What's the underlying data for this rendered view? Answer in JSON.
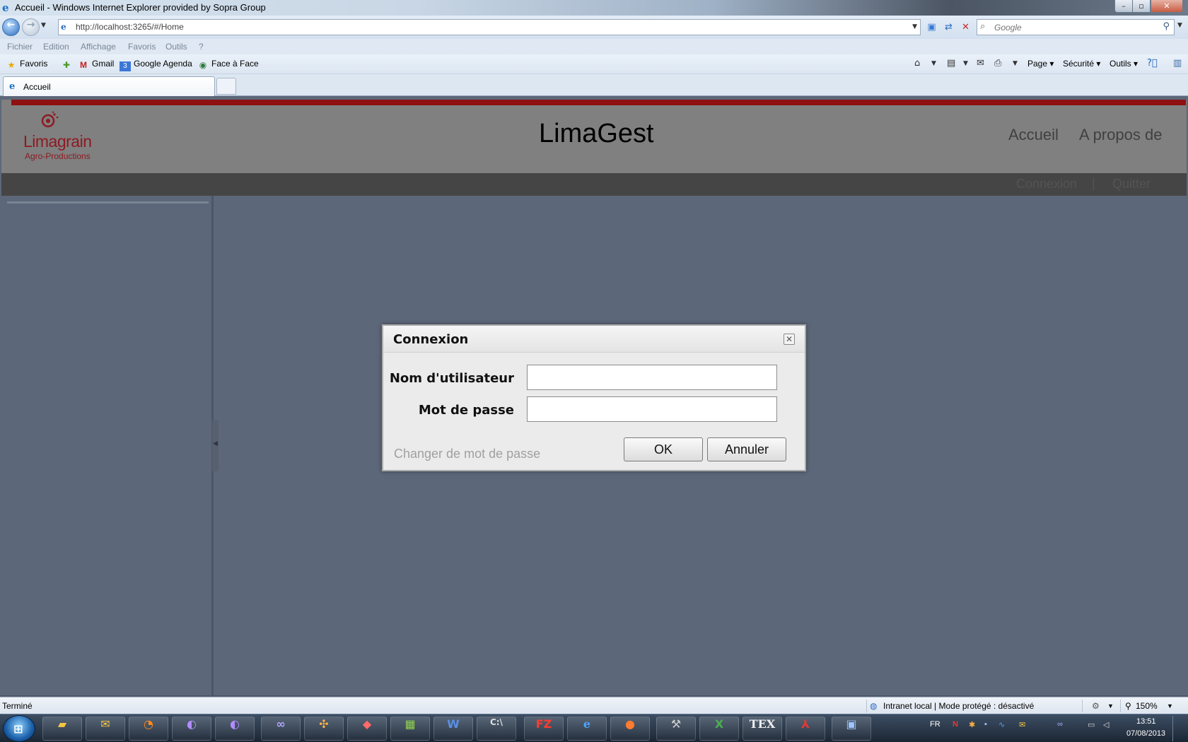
{
  "window": {
    "title": "Accueil - Windows Internet Explorer provided by Sopra Group",
    "minimize_glyph": "–",
    "maximize_glyph": "▫",
    "close_glyph": "✕"
  },
  "browser": {
    "url": "http://localhost:3265/#/Home",
    "search_placeholder": "Google",
    "menu": [
      "Fichier",
      "Edition",
      "Affichage",
      "Favoris",
      "Outils",
      "?"
    ],
    "favorites_label": "Favoris",
    "favorites": [
      "Gmail",
      "Google Agenda",
      "Face à Face"
    ],
    "commands": [
      "Page",
      "Sécurité",
      "Outils"
    ],
    "tab_label": "Accueil"
  },
  "app": {
    "logo_brand": "Limagrain",
    "logo_sub": "Agro-Productions",
    "title": "LimaGest",
    "nav": [
      "Accueil",
      "A propos de"
    ],
    "subnav": [
      "Connexion",
      "|",
      "Quitter"
    ]
  },
  "dialog": {
    "title": "Connexion",
    "username_label": "Nom d'utilisateur",
    "password_label": "Mot de passe",
    "username_value": "",
    "password_value": "",
    "change_password_link": "Changer de mot de passe",
    "ok_label": "OK",
    "cancel_label": "Annuler"
  },
  "statusbar": {
    "left": "Terminé",
    "zone": "Intranet local | Mode protégé : désactivé",
    "zoom": "150%"
  },
  "taskbar": {
    "language": "FR",
    "time": "13:51",
    "date": "07/08/2013",
    "apps": [
      "explorer-icon",
      "outlook-icon",
      "ubuntu-one-icon",
      "eclipse-icon",
      "eclipse-icon",
      "visual-studio-icon",
      "infrastructure-icon",
      "mindmap-icon",
      "project-icon",
      "word-icon",
      "cmd-icon",
      "filezilla-icon",
      "internet-explorer-icon",
      "firefox-icon",
      "tools-icon",
      "excel-icon",
      "tex-icon",
      "acrobat-icon",
      "paint-icon"
    ]
  },
  "colors": {
    "header_red": "#8e1010",
    "header_gray": "#808080",
    "subbar": "#454545",
    "content_bg": "#5c6779",
    "logo_red": "#8e1a22"
  }
}
